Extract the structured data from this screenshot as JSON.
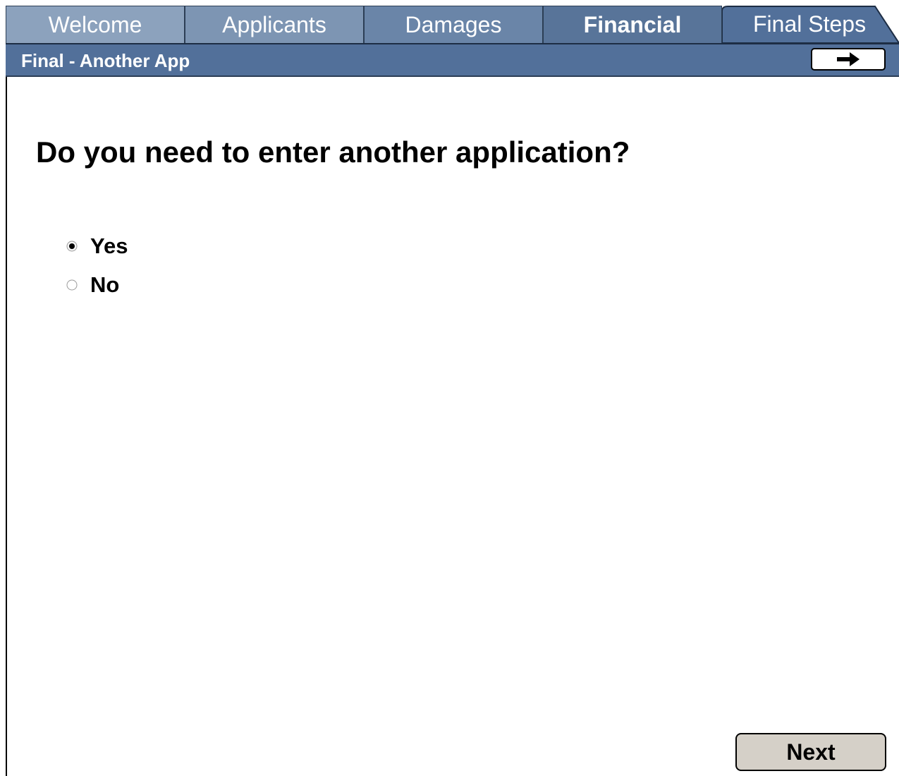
{
  "tabs": [
    {
      "label": "Welcome"
    },
    {
      "label": "Applicants"
    },
    {
      "label": "Damages"
    },
    {
      "label": "Financial",
      "active": true
    },
    {
      "label": "Final Steps"
    }
  ],
  "subheader": {
    "title": "Final - Another App",
    "forward_icon": "right-arrow-icon"
  },
  "question": {
    "text": "Do you need to enter another application?"
  },
  "options": [
    {
      "label": "Yes",
      "selected": true
    },
    {
      "label": "No",
      "selected": false
    }
  ],
  "footer": {
    "next_label": "Next"
  },
  "colors": {
    "tab_header": "#587499",
    "subbar": "#52709a",
    "next_button": "#d5d0c8"
  }
}
